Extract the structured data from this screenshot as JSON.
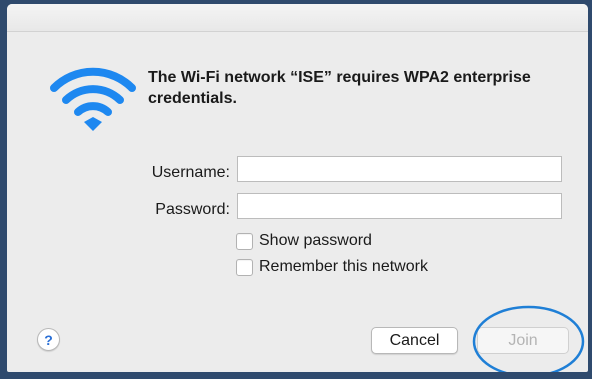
{
  "dialog": {
    "message": "The Wi-Fi network “ISE” requires WPA2 enterprise credentials.",
    "icon": "wifi-icon",
    "accent_color": "#1e88f0"
  },
  "form": {
    "username_label": "Username:",
    "username_value": "",
    "password_label": "Password:",
    "password_value": ""
  },
  "options": {
    "show_password_label": "Show password",
    "show_password_checked": false,
    "remember_label": "Remember this network",
    "remember_checked": false
  },
  "buttons": {
    "help_label": "?",
    "cancel_label": "Cancel",
    "join_label": "Join",
    "join_enabled": false
  },
  "annotation": {
    "highlight_color": "#1f7fd6"
  }
}
